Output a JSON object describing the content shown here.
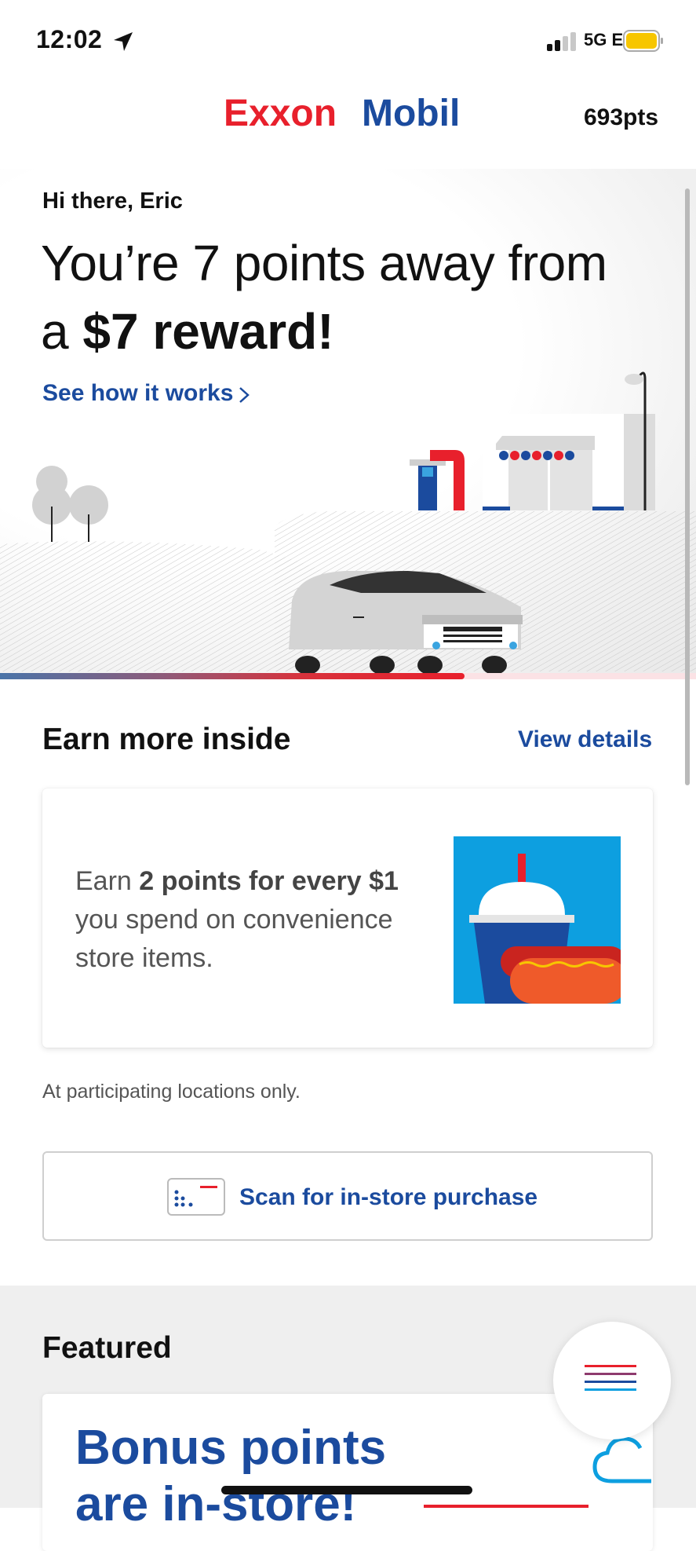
{
  "status": {
    "time": "12:02",
    "network": "5G E"
  },
  "header": {
    "points": "693pts",
    "brand": {
      "exxon": "Exxon",
      "mobil": "Mobil",
      "red": "#e8202c",
      "blue": "#1b4b9e"
    }
  },
  "hero": {
    "greeting": "Hi there, Eric",
    "headline_line1": "You’re 7 points away from",
    "headline_line2_prefix": "a ",
    "headline_line2_bold": "$7 reward!",
    "link_label": "See how it works",
    "progress": 0.75
  },
  "earn": {
    "title": "Earn more inside",
    "view_details": "View details",
    "card_text_prefix": "Earn ",
    "card_text_bold": "2 points for every $1",
    "card_text_suffix": " you spend on convenience store items.",
    "image_icon": "drink-and-hotdog-icon"
  },
  "participating": "At participating locations only.",
  "scan": {
    "label": "Scan for in-store purchase",
    "icon": "barcode-scan-icon"
  },
  "featured": {
    "title": "Featured",
    "card_title_line1": "Bonus points",
    "card_title_line2": "are in-store!"
  }
}
